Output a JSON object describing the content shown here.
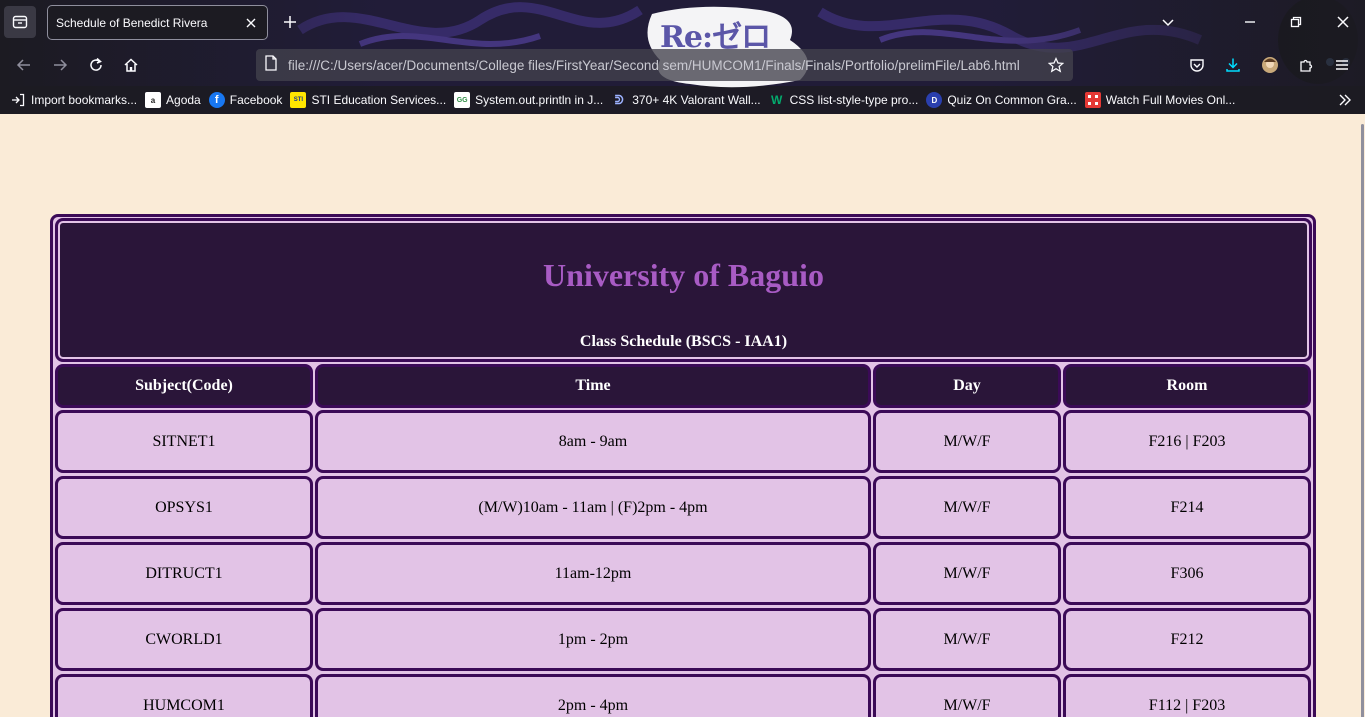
{
  "browser": {
    "tab_title": "Schedule of Benedict Rivera",
    "url": "file:///C:/Users/acer/Documents/College files/FirstYear/Second sem/HUMCOM1/Finals/Finals/Portfolio/prelimFile/Lab6.html",
    "theme_logo_text": "Re:ゼロ",
    "bookmarks": [
      {
        "label": "Import bookmarks...",
        "icon": "import-icon"
      },
      {
        "label": "Agoda",
        "icon": "agoda-icon"
      },
      {
        "label": "Facebook",
        "icon": "facebook-icon"
      },
      {
        "label": "STI Education Services...",
        "icon": "sti-icon"
      },
      {
        "label": "System.out.println in J...",
        "icon": "geeksforgeeks-icon"
      },
      {
        "label": "370+ 4K Valorant Wall...",
        "icon": "valorant-icon"
      },
      {
        "label": "CSS list-style-type pro...",
        "icon": "w3-icon"
      },
      {
        "label": "Quiz On Common Gra...",
        "icon": "quiz-icon"
      },
      {
        "label": "Watch Full Movies Onl...",
        "icon": "movies-icon"
      }
    ]
  },
  "page": {
    "title": "University of Baguio",
    "subtitle": "Class Schedule (BSCS - IAA1)",
    "columns": [
      "Subject(Code)",
      "Time",
      "Day",
      "Room"
    ],
    "rows": [
      [
        "SITNET1",
        "8am - 9am",
        "M/W/F",
        "F216 | F203"
      ],
      [
        "OPSYS1",
        "(M/W)10am - 11am | (F)2pm - 4pm",
        "M/W/F",
        "F214"
      ],
      [
        "DITRUCT1",
        "11am-12pm",
        "M/W/F",
        "F306"
      ],
      [
        "CWORLD1",
        "1pm - 2pm",
        "M/W/F",
        "F212"
      ],
      [
        "HUMCOM1",
        "2pm - 4pm",
        "M/W/F",
        "F112 | F203"
      ]
    ]
  },
  "colors": {
    "page_bg": "#faebd7",
    "header_bg": "#2a1539",
    "cell_bg": "#e2c3e6",
    "border": "#3b0a57",
    "title": "#a85bc4"
  }
}
